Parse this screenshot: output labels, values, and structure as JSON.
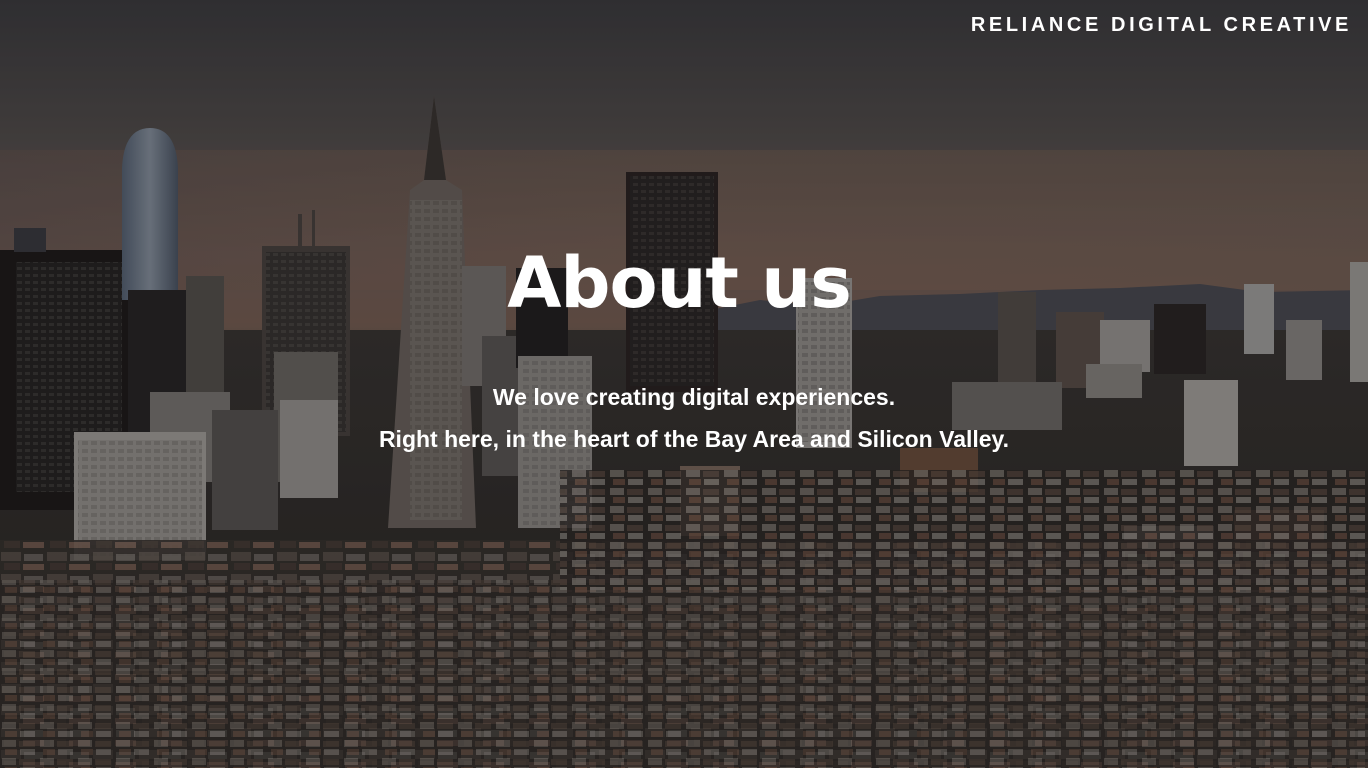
{
  "header": {
    "brand_name": "RELIANCE DIGITAL CREATIVE"
  },
  "hero": {
    "title": "About us",
    "tagline_line_1": "We love creating digital experiences.",
    "tagline_line_2": "Right here, in the heart of the Bay Area and Silicon Valley.",
    "background": "city-skyline-photo"
  },
  "colors": {
    "text": "#ffffff",
    "sky_top": "#4e4b4e",
    "sky_horizon": "#7d6457",
    "city_dark": "#1f1d1e"
  }
}
